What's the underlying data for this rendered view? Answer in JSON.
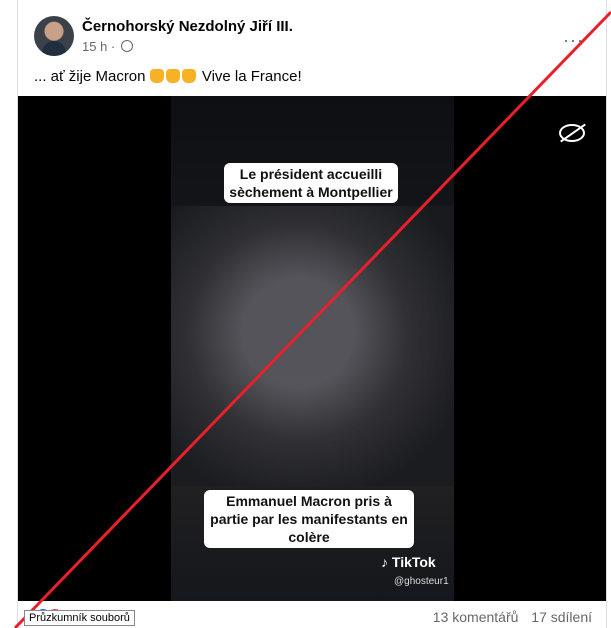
{
  "post": {
    "author": "Černohorský Nezdolný Jiří III.",
    "time": "15 h ·",
    "text": "... ať žije Macron",
    "text_end": "Vive la France!",
    "more_label": "···"
  },
  "video": {
    "caption_top": "Le président accueilli sèchement à Montpellier",
    "caption_bottom": "Emmanuel Macron pris à partie par les manifestants en colère",
    "watermark": "TikTok",
    "handle": "@ghosteur1"
  },
  "footer": {
    "comments": "13 komentářů",
    "shares": "17 sdílení"
  },
  "tooltip": "Průzkumník souborů",
  "icons": {
    "hide_media": "eye-slash-icon",
    "privacy": "globe-icon",
    "emoji": "thumbs-up-icon",
    "reactions": "like-love-reaction-icons"
  },
  "colors": {
    "strike_line": "#e8202a",
    "video_bg": "#000000"
  }
}
